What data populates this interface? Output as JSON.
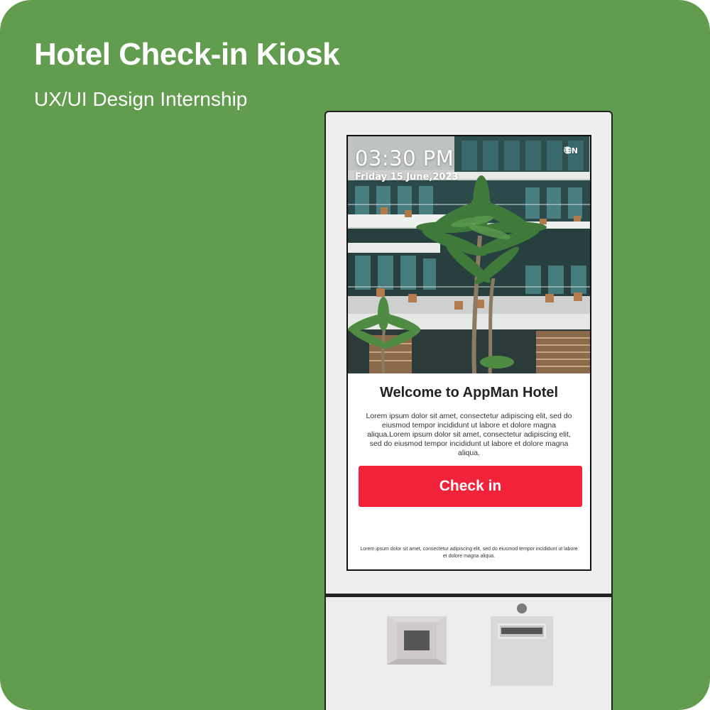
{
  "header": {
    "title": "Hotel Check-in Kiosk",
    "subtitle": "UX/UI Design Internship"
  },
  "kiosk_screen": {
    "time": "03:30 PM",
    "date": "Friday 15 June,2023",
    "language": {
      "icon": "globe-icon",
      "value": "EN",
      "dropdown_icon": "caret-down-icon"
    },
    "hero_image": "hotel-courtyard-palm-trees",
    "welcome_title": "Welcome to AppMan Hotel",
    "description": "Lorem ipsum dolor sit amet, consectetur adipiscing elit, sed do eiusmod tempor incididunt ut labore et dolore magna aliqua.Lorem ipsum dolor sit amet, consectetur adipiscing elit, sed do eiusmod tempor incididunt ut labore et dolore magna aliqua.",
    "checkin_label": "Check in",
    "footnote": "Lorem ipsum dolor sit amet, consectetur adipiscing elit, sed do eiusmod tempor incididunt ut labore et dolore magna aliqua."
  },
  "colors": {
    "background": "#629c4e",
    "accent_button": "#f0233a",
    "kiosk_body": "#eeeeee"
  },
  "hardware": {
    "card_reader": "card-reader-slot",
    "camera": "camera-lens",
    "printer": "receipt-printer-slot"
  }
}
